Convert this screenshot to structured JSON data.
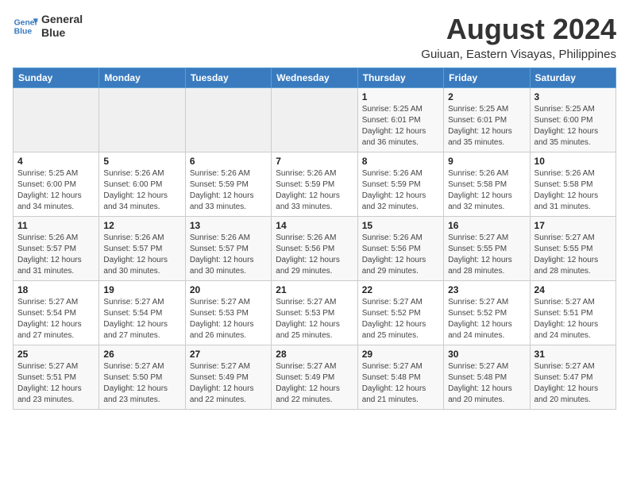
{
  "header": {
    "title": "August 2024",
    "subtitle": "Guiuan, Eastern Visayas, Philippines",
    "logo_line1": "General",
    "logo_line2": "Blue"
  },
  "weekdays": [
    "Sunday",
    "Monday",
    "Tuesday",
    "Wednesday",
    "Thursday",
    "Friday",
    "Saturday"
  ],
  "weeks": [
    [
      {
        "day": "",
        "info": ""
      },
      {
        "day": "",
        "info": ""
      },
      {
        "day": "",
        "info": ""
      },
      {
        "day": "",
        "info": ""
      },
      {
        "day": "1",
        "info": "Sunrise: 5:25 AM\nSunset: 6:01 PM\nDaylight: 12 hours\nand 36 minutes."
      },
      {
        "day": "2",
        "info": "Sunrise: 5:25 AM\nSunset: 6:01 PM\nDaylight: 12 hours\nand 35 minutes."
      },
      {
        "day": "3",
        "info": "Sunrise: 5:25 AM\nSunset: 6:00 PM\nDaylight: 12 hours\nand 35 minutes."
      }
    ],
    [
      {
        "day": "4",
        "info": "Sunrise: 5:25 AM\nSunset: 6:00 PM\nDaylight: 12 hours\nand 34 minutes."
      },
      {
        "day": "5",
        "info": "Sunrise: 5:26 AM\nSunset: 6:00 PM\nDaylight: 12 hours\nand 34 minutes."
      },
      {
        "day": "6",
        "info": "Sunrise: 5:26 AM\nSunset: 5:59 PM\nDaylight: 12 hours\nand 33 minutes."
      },
      {
        "day": "7",
        "info": "Sunrise: 5:26 AM\nSunset: 5:59 PM\nDaylight: 12 hours\nand 33 minutes."
      },
      {
        "day": "8",
        "info": "Sunrise: 5:26 AM\nSunset: 5:59 PM\nDaylight: 12 hours\nand 32 minutes."
      },
      {
        "day": "9",
        "info": "Sunrise: 5:26 AM\nSunset: 5:58 PM\nDaylight: 12 hours\nand 32 minutes."
      },
      {
        "day": "10",
        "info": "Sunrise: 5:26 AM\nSunset: 5:58 PM\nDaylight: 12 hours\nand 31 minutes."
      }
    ],
    [
      {
        "day": "11",
        "info": "Sunrise: 5:26 AM\nSunset: 5:57 PM\nDaylight: 12 hours\nand 31 minutes."
      },
      {
        "day": "12",
        "info": "Sunrise: 5:26 AM\nSunset: 5:57 PM\nDaylight: 12 hours\nand 30 minutes."
      },
      {
        "day": "13",
        "info": "Sunrise: 5:26 AM\nSunset: 5:57 PM\nDaylight: 12 hours\nand 30 minutes."
      },
      {
        "day": "14",
        "info": "Sunrise: 5:26 AM\nSunset: 5:56 PM\nDaylight: 12 hours\nand 29 minutes."
      },
      {
        "day": "15",
        "info": "Sunrise: 5:26 AM\nSunset: 5:56 PM\nDaylight: 12 hours\nand 29 minutes."
      },
      {
        "day": "16",
        "info": "Sunrise: 5:27 AM\nSunset: 5:55 PM\nDaylight: 12 hours\nand 28 minutes."
      },
      {
        "day": "17",
        "info": "Sunrise: 5:27 AM\nSunset: 5:55 PM\nDaylight: 12 hours\nand 28 minutes."
      }
    ],
    [
      {
        "day": "18",
        "info": "Sunrise: 5:27 AM\nSunset: 5:54 PM\nDaylight: 12 hours\nand 27 minutes."
      },
      {
        "day": "19",
        "info": "Sunrise: 5:27 AM\nSunset: 5:54 PM\nDaylight: 12 hours\nand 27 minutes."
      },
      {
        "day": "20",
        "info": "Sunrise: 5:27 AM\nSunset: 5:53 PM\nDaylight: 12 hours\nand 26 minutes."
      },
      {
        "day": "21",
        "info": "Sunrise: 5:27 AM\nSunset: 5:53 PM\nDaylight: 12 hours\nand 25 minutes."
      },
      {
        "day": "22",
        "info": "Sunrise: 5:27 AM\nSunset: 5:52 PM\nDaylight: 12 hours\nand 25 minutes."
      },
      {
        "day": "23",
        "info": "Sunrise: 5:27 AM\nSunset: 5:52 PM\nDaylight: 12 hours\nand 24 minutes."
      },
      {
        "day": "24",
        "info": "Sunrise: 5:27 AM\nSunset: 5:51 PM\nDaylight: 12 hours\nand 24 minutes."
      }
    ],
    [
      {
        "day": "25",
        "info": "Sunrise: 5:27 AM\nSunset: 5:51 PM\nDaylight: 12 hours\nand 23 minutes."
      },
      {
        "day": "26",
        "info": "Sunrise: 5:27 AM\nSunset: 5:50 PM\nDaylight: 12 hours\nand 23 minutes."
      },
      {
        "day": "27",
        "info": "Sunrise: 5:27 AM\nSunset: 5:49 PM\nDaylight: 12 hours\nand 22 minutes."
      },
      {
        "day": "28",
        "info": "Sunrise: 5:27 AM\nSunset: 5:49 PM\nDaylight: 12 hours\nand 22 minutes."
      },
      {
        "day": "29",
        "info": "Sunrise: 5:27 AM\nSunset: 5:48 PM\nDaylight: 12 hours\nand 21 minutes."
      },
      {
        "day": "30",
        "info": "Sunrise: 5:27 AM\nSunset: 5:48 PM\nDaylight: 12 hours\nand 20 minutes."
      },
      {
        "day": "31",
        "info": "Sunrise: 5:27 AM\nSunset: 5:47 PM\nDaylight: 12 hours\nand 20 minutes."
      }
    ]
  ]
}
